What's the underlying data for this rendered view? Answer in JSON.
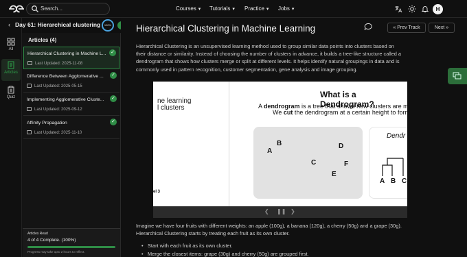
{
  "topbar": {
    "search_placeholder": "Search...",
    "nav": [
      "Courses",
      "Tutorials",
      "Practice",
      "Jobs"
    ],
    "avatar_initial": "H",
    "icons": [
      "translate-icon",
      "sun-icon",
      "bell-icon"
    ]
  },
  "rail": {
    "items": [
      {
        "label": "All",
        "icon": "grid-icon"
      },
      {
        "label": "Articles",
        "icon": "article-icon",
        "active": true
      },
      {
        "label": "Quiz",
        "icon": "quiz-icon"
      }
    ]
  },
  "sidebar": {
    "day_title": "Day 61: Hierarchical clustering",
    "progress_ring": "100%",
    "articles_label": "Articles (4)",
    "articles": [
      {
        "title": "Hierarchical Clustering in Machine L...",
        "updated": "Last Updated: 2025-11-08",
        "active": true
      },
      {
        "title": "Difference Between Agglomerative ...",
        "updated": "Last Updated: 2025-05-15"
      },
      {
        "title": "Implementing Agglomerative Cluste...",
        "updated": "Last Updated: 2025-09-12"
      },
      {
        "title": "Affinity Propagation",
        "updated": "Last Updated: 2025-11-10"
      }
    ],
    "read_box": {
      "label": "Articles Read",
      "count": "4 of 4 Complete. (100%)",
      "progress": 1.0,
      "note": "Progress may take upto 2 hours to reflect."
    }
  },
  "main": {
    "title": "Hierarchical Clustering in Machine Learning",
    "prev_label": "Prev Track",
    "next_label": "Next",
    "para1_line1": "Hierarchical Clustering is an unsupervised learning method used to group similar data points into clusters based on",
    "para1_line2": "their distance or similarity. Instead of choosing the number of clusters in advance, it builds a tree-like structure called a",
    "para1_line3": "dendrogram that shows how clusters merge or split at different levels. It helps identify natural groupings in data and is",
    "para1_line4": "commonly used in pattern recognition, customer segmentation, gene analysis and image grouping.",
    "para2_line1": "Imagine we have four fruits with different weights: an apple (100g), a banana (120g), a cherry (50g) and a grape (30g).",
    "para2_line2": "Hierarchical Clustering starts by treating each fruit as its own cluster.",
    "bullets": [
      "Start with each fruit as its own cluster.",
      "Merge the closest items: grape (30g) and cherry (50g) are grouped first."
    ]
  },
  "slide": {
    "left_line1": "ne learning",
    "left_line2": "l clusters",
    "left_bottom": "el 3",
    "heading": "What is a Dendrogram?",
    "def_prefix": "A ",
    "def_bold": "dendrogram",
    "def_rest": " is a tree that shows how clusters are m",
    "def2_prefix": "We ",
    "def2_bold": "cut",
    "def2_rest": " the dendrogram at a certain height to form",
    "points": [
      "B",
      "A",
      "D",
      "C",
      "F",
      "E"
    ],
    "dendro_label": "Dendr",
    "leaves": [
      "A",
      "B",
      "C"
    ]
  }
}
